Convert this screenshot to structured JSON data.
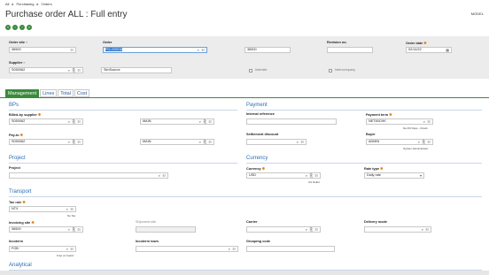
{
  "breadcrumb": {
    "root": "All",
    "sep1": "▸",
    "module": "Purchasing",
    "sep2": "▸",
    "page": "Orders"
  },
  "title": "Purchase order ALL : Full entry",
  "model": "MODEL",
  "nav_buttons": [
    "first",
    "previous",
    "next",
    "last"
  ],
  "header": {
    "order_site": {
      "label": "Order site",
      "value": "36500"
    },
    "order": {
      "label": "Order",
      "value": "PO-220016"
    },
    "order_desc": {
      "value": "36500"
    },
    "revision": {
      "label": "Revision no.",
      "value": ""
    },
    "order_date": {
      "label": "Order date",
      "value": "02/14/22"
    },
    "supplier": {
      "label": "Supplier",
      "value": "S050062"
    },
    "supplier_name": {
      "value": "SimSource"
    },
    "intersite": {
      "label": "Intersite"
    },
    "intercompany": {
      "label": "Intercompany"
    }
  },
  "tabs": [
    "Management",
    "Lines",
    "Total",
    "Cost"
  ],
  "sections": {
    "bps": "BPs",
    "payment": "Payment",
    "project": "Project",
    "currency": "Currency",
    "transport": "Transport",
    "analytical": "Analytical"
  },
  "fields": {
    "billed_by": {
      "label": "Billed-by supplier",
      "value": "S050062",
      "addr": "MAIN"
    },
    "internal_ref": {
      "label": "Internal reference",
      "value": ""
    },
    "payment_term": {
      "label": "Payment term",
      "value": "NET60CHK",
      "hint": "Net 60 Days - Check"
    },
    "pay_to": {
      "label": "Pay-to",
      "value": "S050062",
      "addr": "MAIN"
    },
    "settlement_discount": {
      "label": "Settlement discount",
      "value": ""
    },
    "buyer": {
      "label": "Buyer",
      "value": "ADMIN",
      "hint": "System Administrator"
    },
    "project": {
      "label": "Project",
      "value": ""
    },
    "currency": {
      "label": "Currency",
      "value": "USD",
      "hint": "US Dollar"
    },
    "rate_type": {
      "label": "Rate type",
      "value": "Daily rate"
    },
    "tax_rule": {
      "label": "Tax rule",
      "value": "NTX",
      "hint": "No Tax"
    },
    "invoicing_site": {
      "label": "Invoicing site",
      "value": "36500"
    },
    "shipment_site": {
      "label": "Shipment site",
      "value": ""
    },
    "carrier": {
      "label": "Carrier",
      "value": ""
    },
    "delivery_mode": {
      "label": "Delivery mode",
      "value": ""
    },
    "incoterm": {
      "label": "Incoterm",
      "value": "FOB",
      "hint": "Free on board"
    },
    "incoterm_town": {
      "label": "Incoterm town",
      "value": ""
    },
    "grouping_code": {
      "label": "Grouping code",
      "value": ""
    }
  },
  "colors": {
    "accent_green": "#3a8a3a",
    "section_blue": "#2a6db5",
    "required": "#e07a00"
  }
}
